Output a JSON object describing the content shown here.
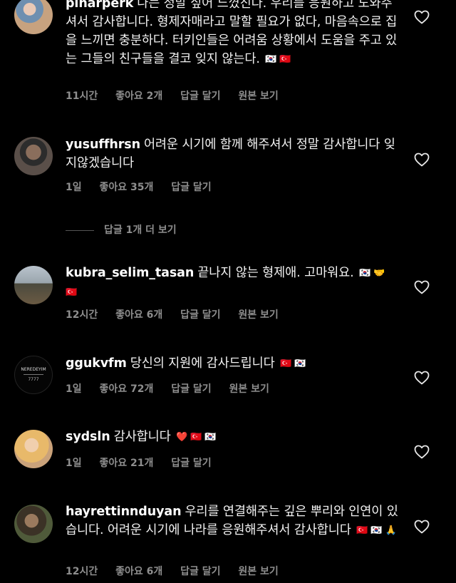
{
  "comments": [
    {
      "username": "pinarperk",
      "text": "나는 정말 싶어 느꼈진다. 우리를 응원하고 도와주셔서 감사합니다. 형제자매라고 말할 필요가 없다, 마음속으로 집을 느끼면 충분하다. 터키인들은 어려움 상황에서 도움을 주고 있는 그들의 친구들을 결코 잊지 않는다.",
      "emoji": "🇰🇷 🇹🇷",
      "time": "11시간",
      "likes": "좋아요 2개",
      "reply": "답글 달기",
      "original": "원본 보기"
    },
    {
      "username": "yusuffhrsn",
      "text": "어려운 시기에 함께 해주셔서 정말 감사합니다 잊지않겠습니다",
      "emoji": "",
      "time": "1일",
      "likes": "좋아요 35개",
      "reply": "답글 달기",
      "original": ""
    },
    {
      "username": "kubra_selim_tasan",
      "text": "끝나지 않는 형제애. 고마워요.",
      "emoji": "🇰🇷 🤝 🇹🇷",
      "time": "12시간",
      "likes": "좋아요 6개",
      "reply": "답글 달기",
      "original": "원본 보기"
    },
    {
      "username": "ggukvfm",
      "text": "당신의 지원에 감사드립니다",
      "emoji": "🇹🇷 🇰🇷",
      "time": "1일",
      "likes": "좋아요 72개",
      "reply": "답글 달기",
      "original": "원본 보기"
    },
    {
      "username": "sydsln",
      "text": "감사합니다",
      "emoji": "❤️ 🇹🇷 🇰🇷",
      "time": "1일",
      "likes": "좋아요 21개",
      "reply": "답글 달기",
      "original": ""
    },
    {
      "username": "hayrettinnduyan",
      "text": "우리를 연결해주는 깊은 뿌리와 인연이 있습니다. 어려운 시기에 나라를 응원해주셔서 감사합니다",
      "emoji": "🇹🇷 🇰🇷 🙏",
      "time": "12시간",
      "likes": "좋아요 6개",
      "reply": "답글 달기",
      "original": "원본 보기"
    }
  ],
  "view_more_replies": "답글 1개 더 보기",
  "logo": {
    "name": "NEREDEYIM",
    "number": "7777"
  },
  "icons": {
    "heart": "heart-outline-icon"
  },
  "colors": {
    "background": "#000000",
    "text": "#f2f2f2",
    "meta": "#8e8e8e"
  }
}
